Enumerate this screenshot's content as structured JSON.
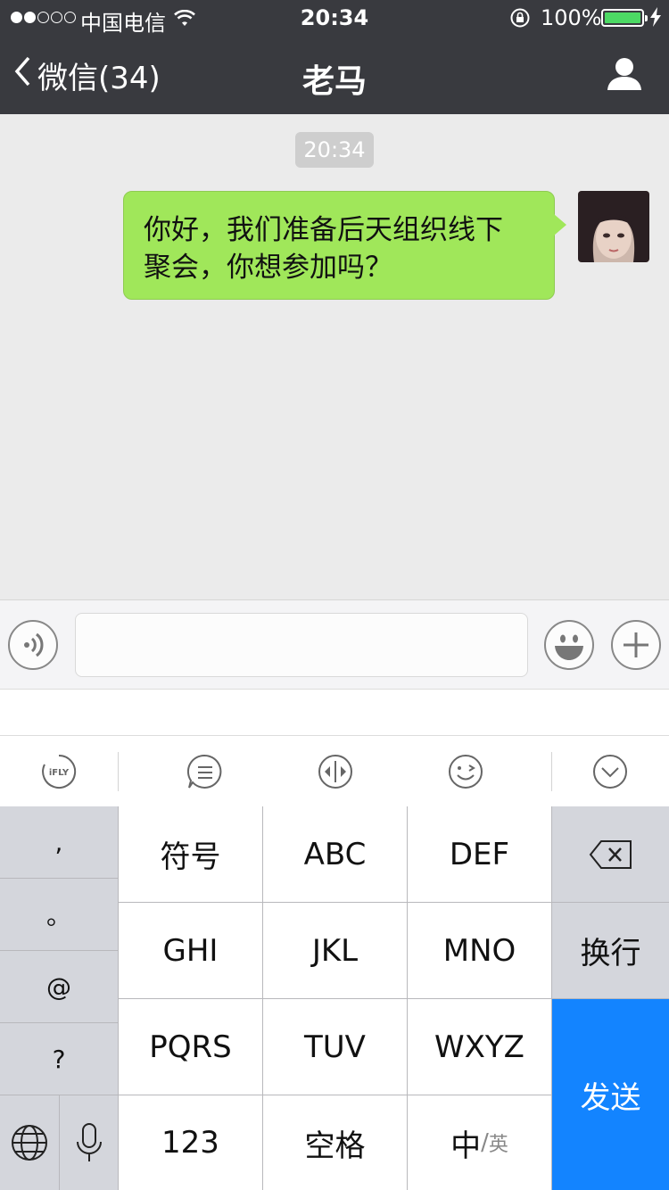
{
  "status_bar": {
    "carrier": "中国电信",
    "time": "20:34",
    "battery": "100%",
    "battery_level": 1.0,
    "signal_filled": 2,
    "signal_total": 5
  },
  "nav": {
    "back_label": "微信(34)",
    "title": "老马"
  },
  "chat": {
    "timestamp": "20:34",
    "messages": [
      {
        "direction": "outgoing",
        "text_line1": "你好，我们准备后天组织线下",
        "text_line2": "聚会，你想参加吗？"
      }
    ]
  },
  "input": {
    "placeholder": ""
  },
  "keyboard": {
    "toolbar_logo": "iFLY",
    "punct": [
      ",",
      "。",
      "@",
      "?"
    ],
    "keys": {
      "symbols": "符号",
      "abc": "ABC",
      "def": "DEF",
      "ghi": "GHI",
      "jkl": "JKL",
      "mno": "MNO",
      "newline": "换行",
      "pqrs": "PQRS",
      "tuv": "TUV",
      "wxyz": "WXYZ",
      "send": "发送",
      "num": "123",
      "space": "空格",
      "lang_main": "中",
      "lang_sub": "英"
    }
  },
  "colors": {
    "nav_bg": "#393a3f",
    "bubble_green": "#a0e75a",
    "send_blue": "#1384ff",
    "battery_green": "#4cd964"
  }
}
